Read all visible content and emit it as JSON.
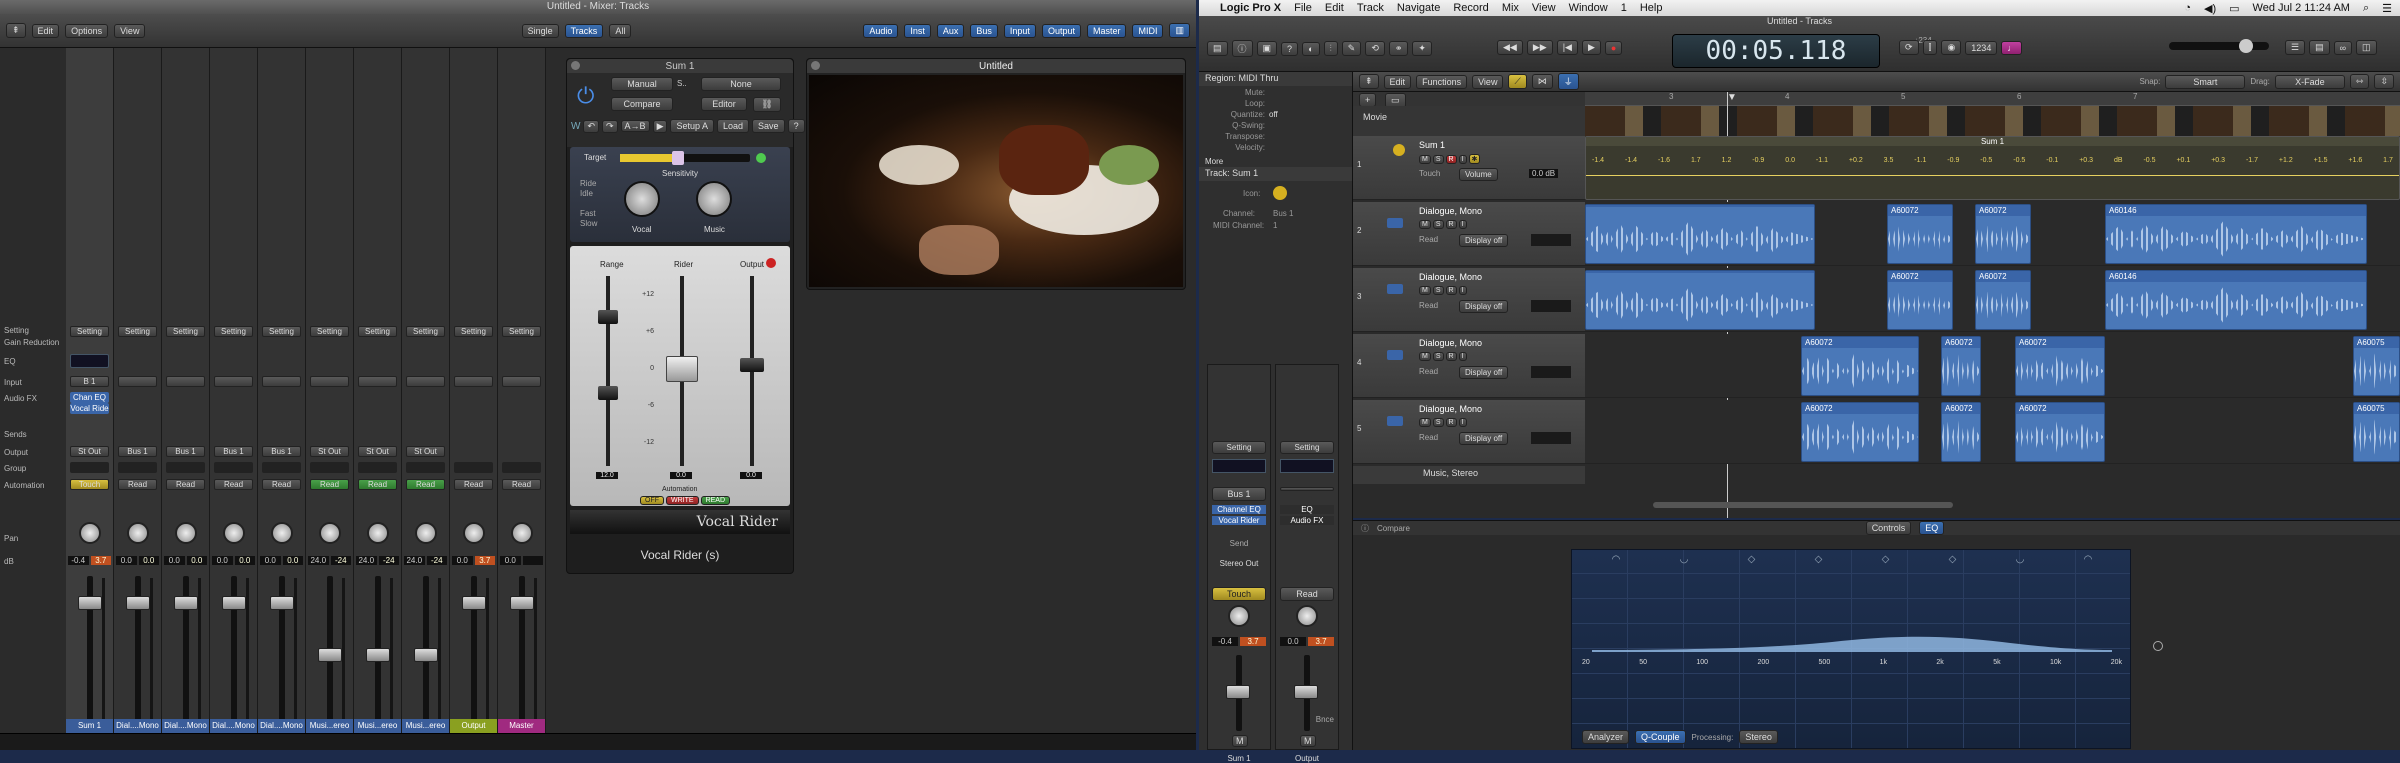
{
  "mixer": {
    "title": "Untitled - Mixer: Tracks",
    "menu": [
      "Edit",
      "Options",
      "View"
    ],
    "view_buttons": [
      "Single",
      "Tracks",
      "All"
    ],
    "filter_buttons": [
      "Audio",
      "Inst",
      "Aux",
      "Bus",
      "Input",
      "Output",
      "Master",
      "MIDI"
    ],
    "row_labels": {
      "setting": "Setting",
      "gain_reduction": "Gain Reduction",
      "eq": "EQ",
      "input": "Input",
      "audio_fx": "Audio FX",
      "sends": "Sends",
      "output": "Output",
      "group": "Group",
      "automation": "Automation",
      "pan": "Pan",
      "db": "dB"
    },
    "strips": [
      {
        "name": "Sum 1",
        "input": "B 1",
        "fx": [
          "Chan EQ",
          "Vocal Ride"
        ],
        "output": "St Out",
        "automation": "Touch",
        "db_a": "-0.4",
        "db_b": "3.7",
        "color": "#3a5d9a"
      },
      {
        "name": "Dial....Mono",
        "input": "",
        "fx": [],
        "output": "Bus 1",
        "automation": "Read",
        "db_a": "0.0",
        "db_b": "0.0",
        "color": "#3a5d9a"
      },
      {
        "name": "Dial....Mono",
        "input": "",
        "fx": [],
        "output": "Bus 1",
        "automation": "Read",
        "db_a": "0.0",
        "db_b": "0.0",
        "color": "#3a5d9a"
      },
      {
        "name": "Dial....Mono",
        "input": "",
        "fx": [],
        "output": "Bus 1",
        "automation": "Read",
        "db_a": "0.0",
        "db_b": "0.0",
        "color": "#3a5d9a"
      },
      {
        "name": "Dial....Mono",
        "input": "",
        "fx": [],
        "output": "Bus 1",
        "automation": "Read",
        "db_a": "0.0",
        "db_b": "0.0",
        "color": "#3a5d9a"
      },
      {
        "name": "Musi...ereo",
        "input": "",
        "fx": [],
        "output": "St Out",
        "automation": "Read",
        "db_a": "24.0",
        "db_b": "-24",
        "color": "#3a5d9a"
      },
      {
        "name": "Musi...ereo",
        "input": "",
        "fx": [],
        "output": "St Out",
        "automation": "Read",
        "db_a": "24.0",
        "db_b": "-24",
        "color": "#3a5d9a"
      },
      {
        "name": "Musi...ereo",
        "input": "",
        "fx": [],
        "output": "St Out",
        "automation": "Read",
        "db_a": "24.0",
        "db_b": "-24",
        "color": "#3a5d9a"
      },
      {
        "name": "Output",
        "input": "",
        "fx": [],
        "output": "",
        "automation": "Read",
        "db_a": "0.0",
        "db_b": "3.7",
        "color": "#8aa020"
      },
      {
        "name": "Master",
        "input": "",
        "fx": [],
        "output": "",
        "automation": "Read",
        "db_a": "0.0",
        "db_b": "",
        "color": "#a02a80"
      }
    ],
    "setting_label": "Setting"
  },
  "plugin": {
    "title": "Sum 1",
    "mode": "Manual",
    "side": "None",
    "compare": "Compare",
    "editor": "Editor",
    "setup": "Setup A",
    "load": "Load",
    "save": "Save",
    "target": "Target",
    "sensitivity": "Sensitivity",
    "vocal": "Vocal",
    "music": "Music",
    "ride": "Ride",
    "idle": "Idle",
    "fast": "Fast",
    "slow": "Slow",
    "range": "Range",
    "rider": "Rider",
    "output": "Output",
    "scale": [
      "+12",
      "+6",
      "0",
      "-6",
      "-12"
    ],
    "range_val": "12.0",
    "rider_val": "0.0",
    "output_val": "0.0",
    "automation": "Automation",
    "auto_buttons": [
      "OFF",
      "WRITE",
      "READ"
    ],
    "brand": "Vocal Rider",
    "footer": "Vocal Rider (s)"
  },
  "video": {
    "title": "Untitled"
  },
  "menubar": {
    "items": [
      "Logic Pro X",
      "File",
      "Edit",
      "Track",
      "Navigate",
      "Record",
      "Mix",
      "View",
      "Window",
      "1",
      "Help"
    ],
    "clock": "Wed Jul 2  11:24 AM"
  },
  "transport": {
    "time": "00:05.118",
    "window_title": "Untitled - Tracks",
    "cpu": "↓234"
  },
  "inspector": {
    "region_header": "Region: MIDI Thru",
    "params": [
      [
        "Mute:",
        ""
      ],
      [
        "Loop:",
        ""
      ],
      [
        "Quantize:",
        "off"
      ],
      [
        "Q-Swing:",
        ""
      ],
      [
        "Transpose:",
        ""
      ],
      [
        "Velocity:",
        ""
      ]
    ],
    "more": "More",
    "track_header": "Track:  Sum 1",
    "icon": "Icon:",
    "channel": "Channel:",
    "channel_val": "Bus 1",
    "midi": "MIDI Channel:",
    "midi_val": "1",
    "strips": [
      {
        "name": "Sum 1",
        "setting": "Setting",
        "input": "Bus 1",
        "fx": [
          "Channel EQ",
          "Vocal Rider"
        ],
        "send": "Send",
        "output": "Stereo Out",
        "auto": "Touch",
        "db_a": "-0.4",
        "db_b": "3.7"
      },
      {
        "name": "Output",
        "setting": "Setting",
        "input": "",
        "fx": [
          "EQ",
          "Audio FX"
        ],
        "send": "",
        "output": "",
        "auto": "Read",
        "db_a": "0.0",
        "db_b": "3.7",
        "extra": "Bnce"
      }
    ]
  },
  "tracks": {
    "menu": [
      "Edit",
      "Functions",
      "View"
    ],
    "snap_label": "Snap:",
    "snap": "Smart",
    "drag_label": "Drag:",
    "drag": "X-Fade",
    "movie": "Movie",
    "ruler": [
      "3",
      "4",
      "5",
      "6",
      "7"
    ],
    "rows": [
      {
        "num": "1",
        "name": "Sum 1",
        "auto": "Touch",
        "param": "Volume",
        "value": "0.0 dB",
        "kind": "sum"
      },
      {
        "num": "2",
        "name": "Dialogue, Mono",
        "auto": "Read",
        "param": "Display off",
        "kind": "audio"
      },
      {
        "num": "3",
        "name": "Dialogue, Mono",
        "auto": "Read",
        "param": "Display off",
        "kind": "audio"
      },
      {
        "num": "4",
        "name": "Dialogue, Mono",
        "auto": "Read",
        "param": "Display off",
        "kind": "audio"
      },
      {
        "num": "5",
        "name": "Dialogue, Mono",
        "auto": "Read",
        "param": "Display off",
        "kind": "audio"
      }
    ],
    "last_row": "Music, Stereo",
    "region_names": [
      "A60072",
      "A60072",
      "A60146",
      "A60072",
      "A60072",
      "A60075"
    ],
    "sum_region": "Sum 1",
    "auto_values": [
      "-1.4",
      "-1.4",
      "-1.6",
      "1.7",
      "1.2",
      "-0.9",
      "0.0",
      "-1.1",
      "+0.2",
      "3.5",
      "-1.1",
      "-0.9",
      "-0.5",
      "-0.5",
      "-0.1",
      "+0.3",
      "dB",
      "-0.5",
      "+0.1",
      "+0.3",
      "-1.7",
      "+1.2",
      "+1.5",
      "+1.6",
      "1.7"
    ]
  },
  "eq": {
    "compare": "Compare",
    "tabs": [
      "Controls",
      "EQ"
    ],
    "freqs": [
      "20",
      "50",
      "100",
      "200",
      "500",
      "1k",
      "2k",
      "5k",
      "10k",
      "20k"
    ],
    "analyzer": "Analyzer",
    "q_couple": "Q-Couple",
    "processing": "Processing:",
    "processing_val": "Stereo"
  }
}
